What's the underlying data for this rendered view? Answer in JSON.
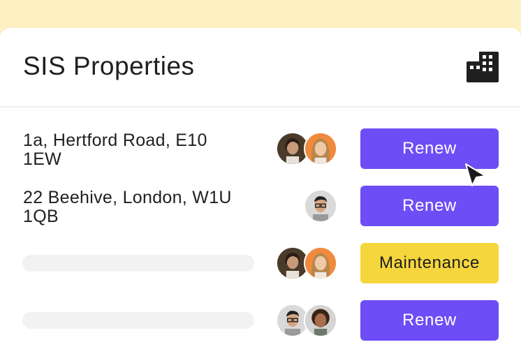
{
  "card": {
    "title": "SIS Properties",
    "icon": "building-icon"
  },
  "rows": [
    {
      "address_line1": "1a, Hertford Road, E10",
      "address_line2": "1EW",
      "action": "Renew",
      "avatars": [
        "woman-dark-hair-avatar",
        "woman-blonde-avatar"
      ]
    },
    {
      "address_line1": "22 Beehive, London, W1U",
      "address_line2": "1QB",
      "action": "Renew",
      "avatars": [
        "man-glasses-avatar"
      ]
    },
    {
      "address_line1": "",
      "address_line2": "",
      "action": "Maintenance",
      "avatars": [
        "woman-dark-hair-avatar",
        "woman-blonde-avatar"
      ]
    },
    {
      "address_line1": "",
      "address_line2": "",
      "action": "Renew",
      "avatars": [
        "man-glasses-avatar",
        "woman-curly-hair-avatar"
      ]
    }
  ],
  "colors": {
    "background": "#fdf1c2",
    "renew_button": "#6d4df5",
    "maintenance_button": "#f5d63d"
  }
}
